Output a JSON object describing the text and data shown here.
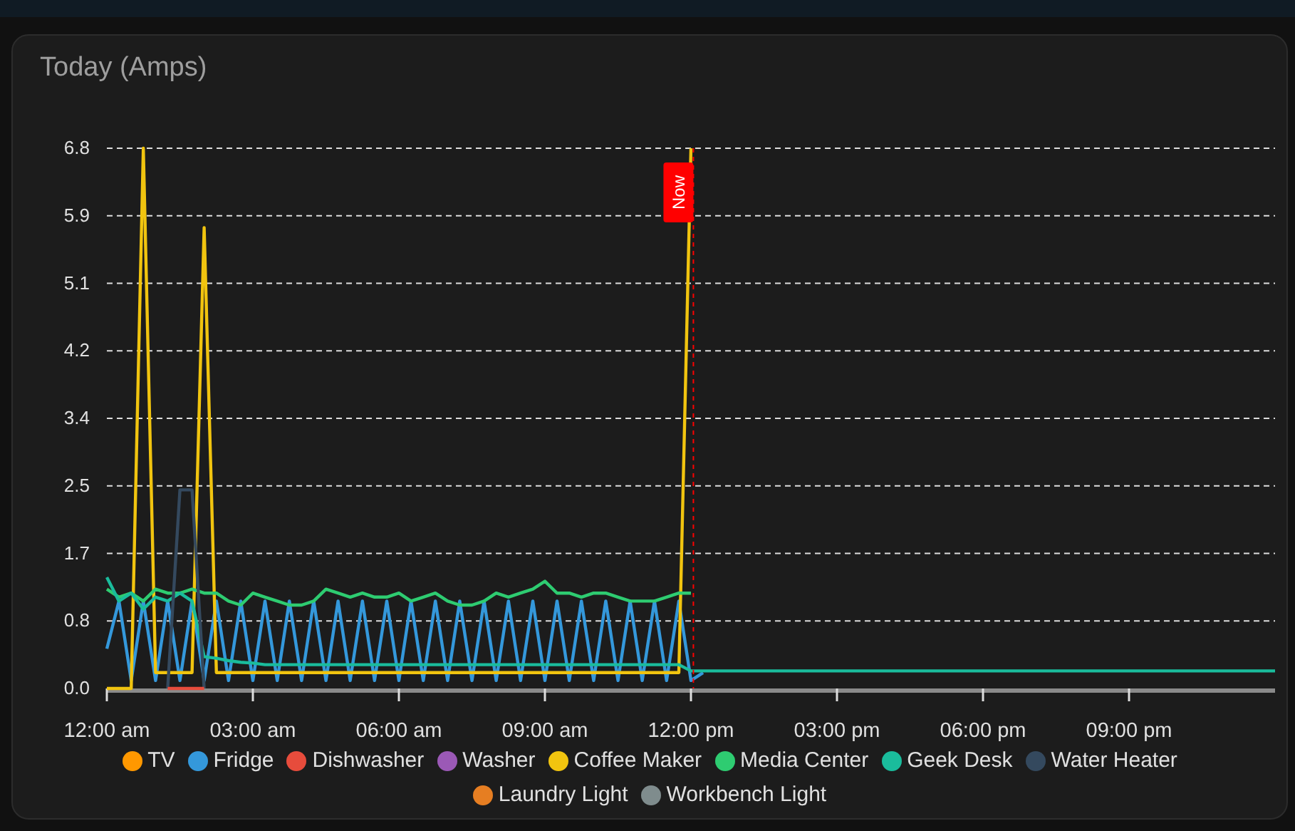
{
  "card": {
    "title": "Today (Amps)",
    "chart_data": {
      "type": "line",
      "x": [
        0,
        0.25,
        0.5,
        0.75,
        1,
        1.25,
        1.5,
        1.75,
        2,
        2.25,
        2.5,
        2.75,
        3,
        3.25,
        3.5,
        3.75,
        4,
        4.25,
        4.5,
        4.75,
        5,
        5.25,
        5.5,
        5.75,
        6,
        6.25,
        6.5,
        6.75,
        7,
        7.25,
        7.5,
        7.75,
        8,
        8.25,
        8.5,
        8.75,
        9,
        9.25,
        9.5,
        9.75,
        10,
        10.25,
        10.5,
        10.75,
        11,
        11.25,
        11.5,
        11.75,
        12,
        12.25,
        24
      ],
      "xlim": [
        0,
        24
      ],
      "ylim": [
        0,
        6.8
      ],
      "xticks": [
        {
          "value": 0,
          "label": "12:00 am"
        },
        {
          "value": 3,
          "label": "03:00 am"
        },
        {
          "value": 6,
          "label": "06:00 am"
        },
        {
          "value": 9,
          "label": "09:00 am"
        },
        {
          "value": 12,
          "label": "12:00 pm"
        },
        {
          "value": 15,
          "label": "03:00 pm"
        },
        {
          "value": 18,
          "label": "06:00 pm"
        },
        {
          "value": 21,
          "label": "09:00 pm"
        }
      ],
      "yticks": [
        {
          "value": 0,
          "label": "0.0"
        },
        {
          "value": 0.85,
          "label": "0.8"
        },
        {
          "value": 1.7,
          "label": "1.7"
        },
        {
          "value": 2.55,
          "label": "2.5"
        },
        {
          "value": 3.4,
          "label": "3.4"
        },
        {
          "value": 4.25,
          "label": "4.2"
        },
        {
          "value": 5.1,
          "label": "5.1"
        },
        {
          "value": 5.95,
          "label": "5.9"
        },
        {
          "value": 6.8,
          "label": "6.8"
        }
      ],
      "grid": true,
      "ref_lines": [
        {
          "axis": "x",
          "value": 12.05,
          "label": "Now",
          "color": "#ff0000"
        }
      ],
      "series": [
        {
          "name": "TV",
          "color": "#ff9800",
          "values": [
            null,
            null,
            null,
            null,
            null,
            null,
            null,
            null,
            null,
            null,
            null,
            null,
            null,
            null,
            null,
            null,
            null,
            null,
            null,
            null,
            null,
            null,
            null,
            null,
            null,
            null,
            null,
            null,
            null,
            null,
            null,
            null,
            null,
            null,
            null,
            null,
            null,
            null,
            null,
            null,
            null,
            null,
            null,
            null,
            null,
            null,
            null,
            null,
            null,
            null,
            null
          ]
        },
        {
          "name": "Fridge",
          "color": "#3498db",
          "values": [
            0.5,
            1.1,
            0.1,
            1.1,
            0.1,
            1.1,
            0.1,
            1.1,
            0.1,
            1.1,
            0.1,
            1.1,
            0.1,
            1.1,
            0.1,
            1.1,
            0.1,
            1.1,
            0.1,
            1.1,
            0.1,
            1.1,
            0.1,
            1.1,
            0.1,
            1.1,
            0.1,
            1.1,
            0.1,
            1.1,
            0.1,
            1.1,
            0.1,
            1.1,
            0.1,
            1.1,
            0.1,
            1.1,
            0.1,
            1.1,
            0.1,
            1.1,
            0.1,
            1.1,
            0.1,
            1.1,
            0.1,
            1.1,
            0.1,
            0.2,
            null
          ]
        },
        {
          "name": "Dishwasher",
          "color": "#e74c3c",
          "values": [
            null,
            null,
            null,
            null,
            null,
            0,
            0,
            0,
            0,
            null,
            null,
            null,
            null,
            null,
            null,
            null,
            null,
            null,
            null,
            null,
            null,
            null,
            null,
            null,
            null,
            null,
            null,
            null,
            null,
            null,
            null,
            null,
            null,
            null,
            null,
            null,
            null,
            null,
            null,
            null,
            null,
            null,
            null,
            null,
            null,
            null,
            null,
            null,
            null,
            null,
            null
          ]
        },
        {
          "name": "Washer",
          "color": "#9b59b6",
          "values": [
            null,
            null,
            null,
            null,
            null,
            null,
            null,
            null,
            null,
            null,
            null,
            null,
            null,
            null,
            null,
            null,
            null,
            null,
            null,
            null,
            null,
            null,
            null,
            null,
            null,
            null,
            null,
            null,
            null,
            null,
            null,
            null,
            null,
            null,
            null,
            null,
            null,
            null,
            null,
            null,
            null,
            null,
            null,
            null,
            null,
            null,
            null,
            null,
            null,
            null,
            null
          ]
        },
        {
          "name": "Coffee Maker",
          "color": "#f1c40f",
          "values": [
            0,
            0,
            0,
            6.8,
            0.2,
            0.2,
            0.2,
            0.2,
            5.8,
            0.2,
            0.2,
            0.2,
            0.2,
            0.2,
            0.2,
            0.2,
            0.2,
            0.2,
            0.2,
            0.2,
            0.2,
            0.2,
            0.2,
            0.2,
            0.2,
            0.2,
            0.2,
            0.2,
            0.2,
            0.2,
            0.2,
            0.2,
            0.2,
            0.2,
            0.2,
            0.2,
            0.2,
            0.2,
            0.2,
            0.2,
            0.2,
            0.2,
            0.2,
            0.2,
            0.2,
            0.2,
            0.2,
            0.2,
            6.8,
            null,
            null
          ]
        },
        {
          "name": "Media Center",
          "color": "#2ecc71",
          "values": [
            1.25,
            1.15,
            1.2,
            1.1,
            1.25,
            1.2,
            1.2,
            1.25,
            1.2,
            1.2,
            1.1,
            1.05,
            1.2,
            1.15,
            1.1,
            1.05,
            1.05,
            1.1,
            1.25,
            1.2,
            1.15,
            1.2,
            1.15,
            1.15,
            1.2,
            1.1,
            1.15,
            1.2,
            1.1,
            1.05,
            1.05,
            1.1,
            1.2,
            1.15,
            1.2,
            1.25,
            1.35,
            1.2,
            1.2,
            1.15,
            1.2,
            1.2,
            1.15,
            1.1,
            1.1,
            1.1,
            1.15,
            1.2,
            1.2,
            null,
            null
          ]
        },
        {
          "name": "Geek Desk",
          "color": "#1abc9c",
          "values": [
            1.4,
            1.1,
            1.2,
            1.0,
            1.15,
            1.1,
            1.2,
            1.1,
            0.4,
            0.38,
            0.35,
            0.33,
            0.32,
            0.3,
            0.3,
            0.3,
            0.3,
            0.3,
            0.3,
            0.3,
            0.3,
            0.3,
            0.3,
            0.3,
            0.3,
            0.3,
            0.3,
            0.3,
            0.3,
            0.3,
            0.3,
            0.3,
            0.3,
            0.3,
            0.3,
            0.3,
            0.3,
            0.3,
            0.3,
            0.3,
            0.3,
            0.3,
            0.3,
            0.3,
            0.3,
            0.3,
            0.3,
            0.3,
            0.22,
            0.22,
            0.22
          ]
        },
        {
          "name": "Water Heater",
          "color": "#34495e",
          "values": [
            null,
            null,
            null,
            null,
            null,
            0,
            2.5,
            2.5,
            0,
            null,
            null,
            null,
            null,
            null,
            null,
            null,
            null,
            null,
            null,
            null,
            null,
            null,
            null,
            null,
            null,
            null,
            null,
            null,
            null,
            null,
            null,
            null,
            null,
            null,
            null,
            null,
            null,
            null,
            null,
            null,
            null,
            null,
            null,
            null,
            null,
            null,
            null,
            null,
            null,
            null,
            null
          ]
        },
        {
          "name": "Laundry Light",
          "color": "#e67e22",
          "values": [
            null,
            null,
            null,
            null,
            null,
            null,
            null,
            null,
            null,
            null,
            null,
            null,
            null,
            null,
            null,
            null,
            null,
            null,
            null,
            null,
            null,
            null,
            null,
            null,
            null,
            null,
            null,
            null,
            null,
            null,
            null,
            null,
            null,
            null,
            null,
            null,
            null,
            null,
            null,
            null,
            null,
            null,
            null,
            null,
            null,
            null,
            null,
            null,
            null,
            null,
            null
          ]
        },
        {
          "name": "Workbench Light",
          "color": "#7f8c8d",
          "values": [
            null,
            null,
            null,
            null,
            null,
            null,
            null,
            null,
            null,
            null,
            null,
            null,
            null,
            null,
            null,
            null,
            null,
            null,
            null,
            null,
            null,
            null,
            null,
            null,
            null,
            null,
            null,
            null,
            null,
            null,
            null,
            null,
            null,
            null,
            null,
            null,
            null,
            null,
            null,
            null,
            null,
            null,
            null,
            null,
            null,
            null,
            null,
            null,
            null,
            null,
            null
          ]
        }
      ]
    }
  }
}
